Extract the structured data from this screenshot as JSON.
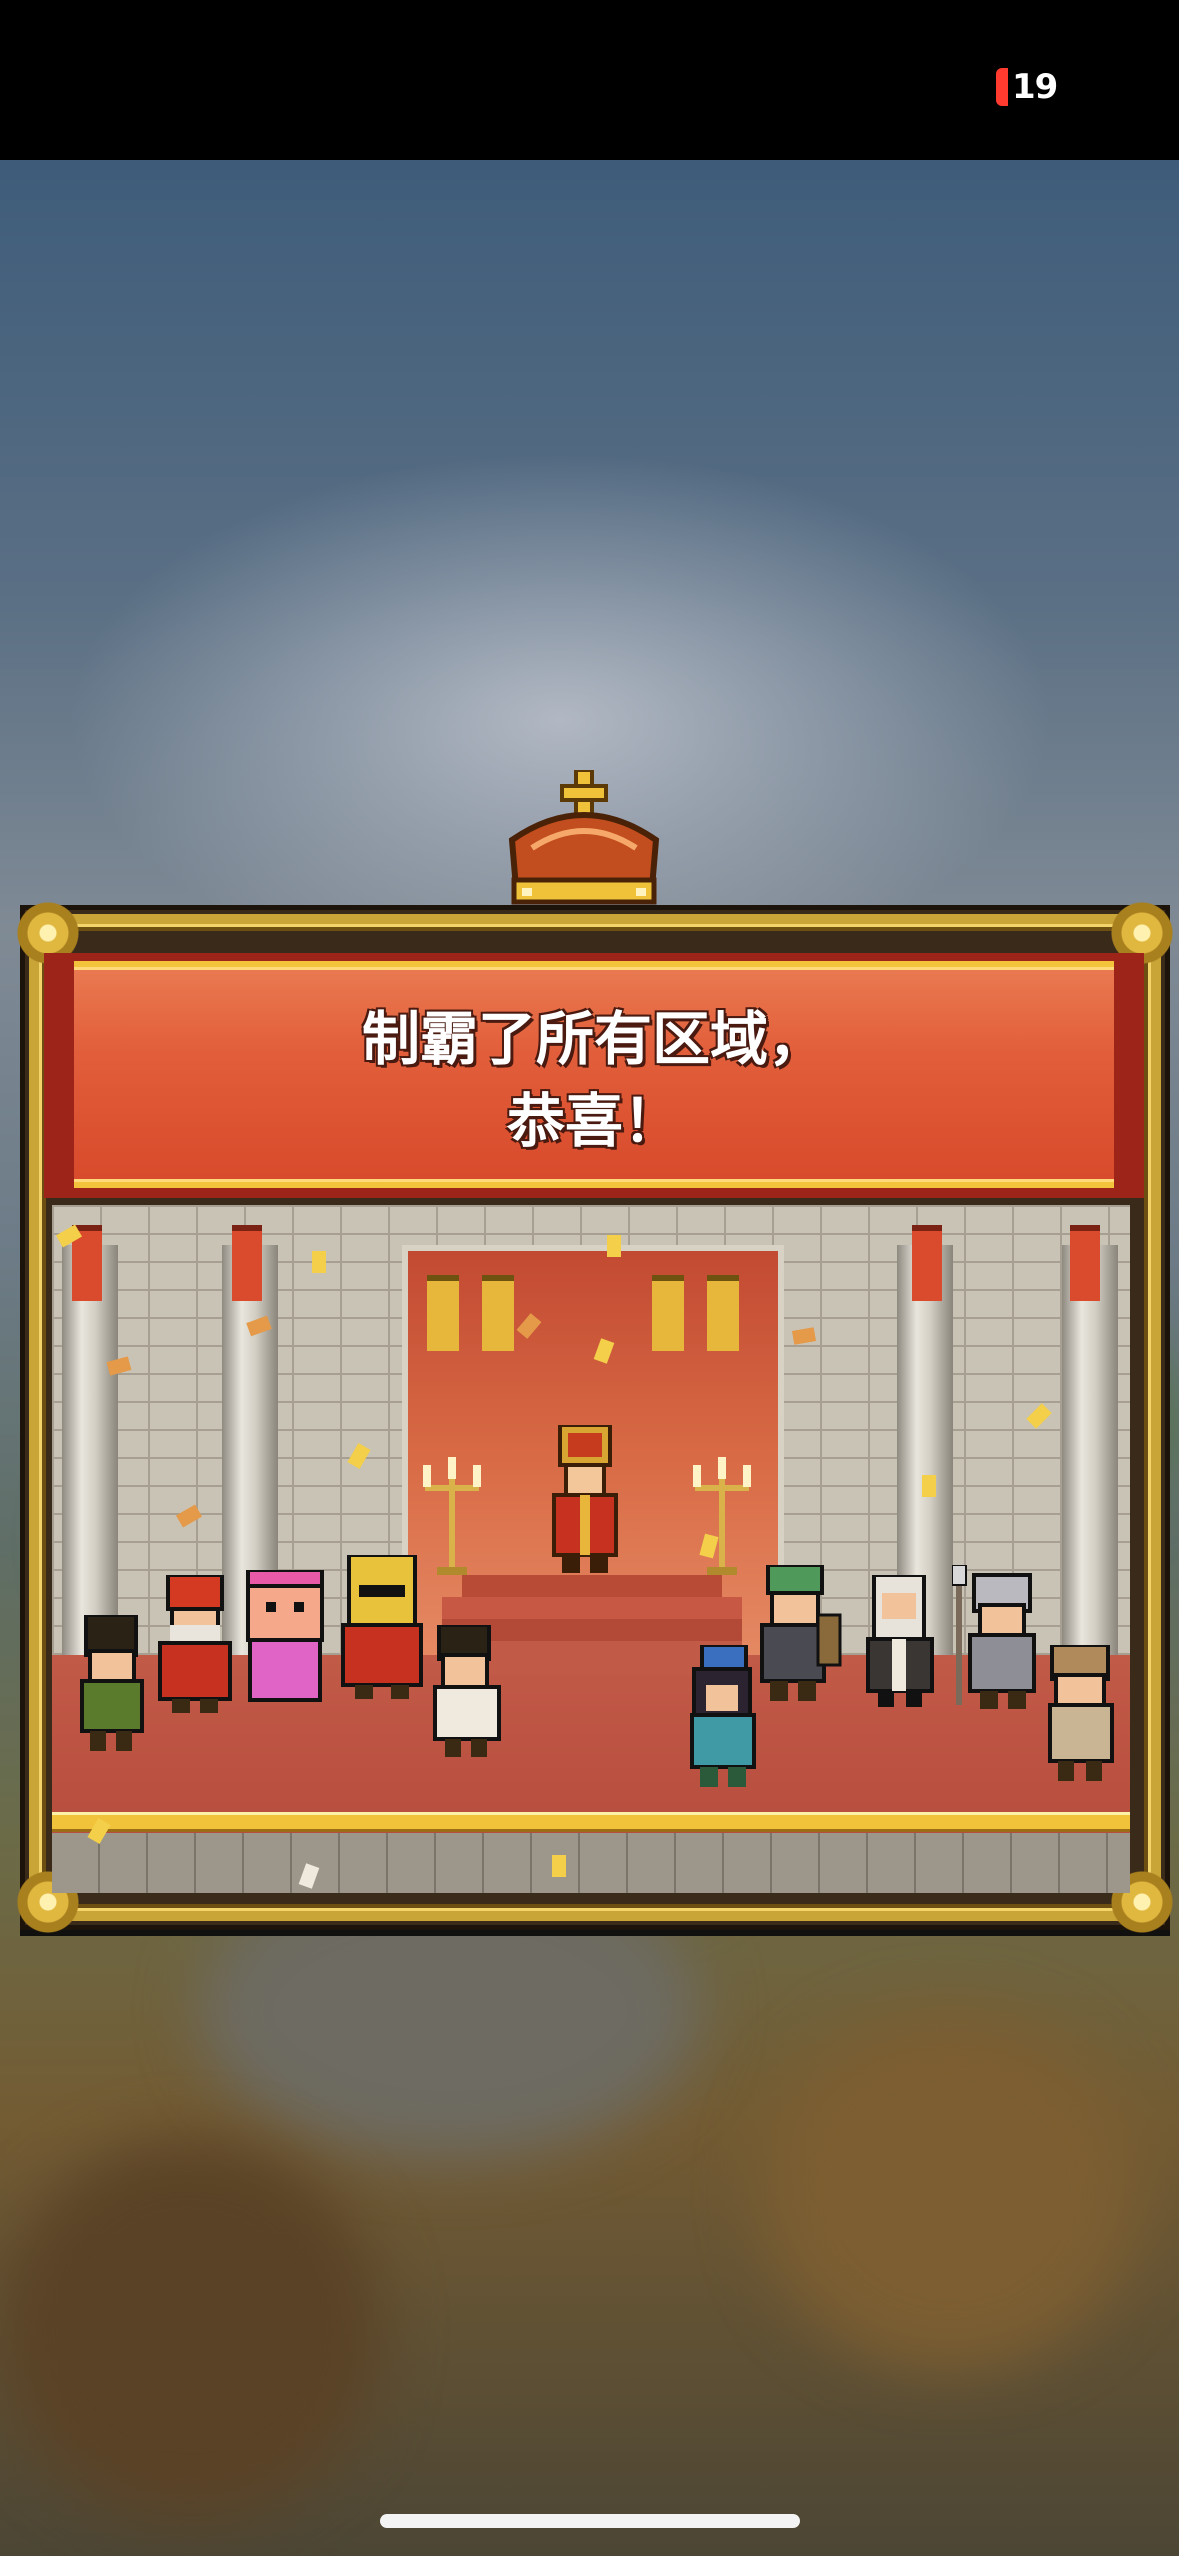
{
  "status_bar": {
    "battery_level": "19",
    "battery_color": "#ff3b30"
  },
  "dialog": {
    "title": "制霸了所有区域，\n恭喜！",
    "icon": "crown-icon",
    "banner_color": "#e25e3a",
    "frame_color": "#c9a437"
  },
  "scene": {
    "description_icon": "castle-throne-room"
  }
}
